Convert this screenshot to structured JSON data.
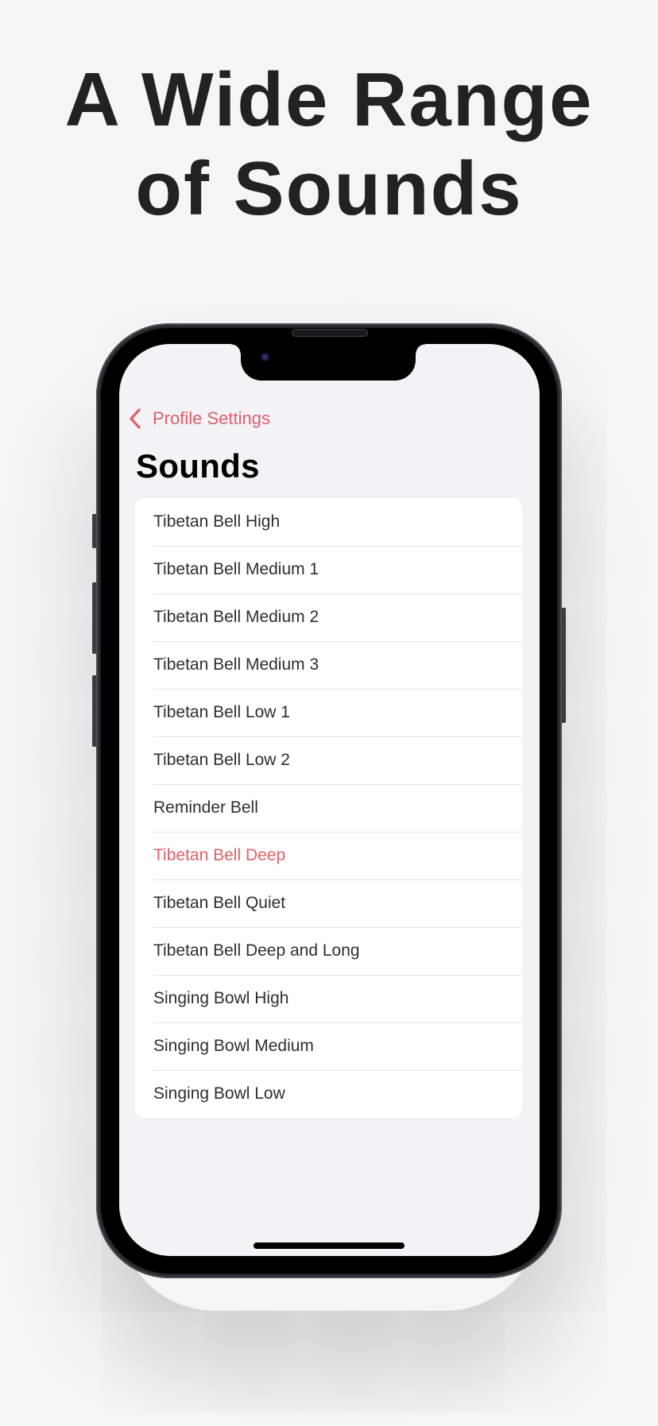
{
  "headline": {
    "line1": "A Wide Range",
    "line2": "of Sounds"
  },
  "nav": {
    "back_icon": "chevron-left-icon",
    "back_label": "Profile Settings"
  },
  "page": {
    "title": "Sounds"
  },
  "sounds": {
    "selected": "Tibetan Bell Deep",
    "items": [
      {
        "label": "Tibetan Bell High"
      },
      {
        "label": "Tibetan Bell Medium 1"
      },
      {
        "label": "Tibetan Bell Medium 2"
      },
      {
        "label": "Tibetan Bell Medium 3"
      },
      {
        "label": "Tibetan Bell Low 1"
      },
      {
        "label": "Tibetan Bell Low 2"
      },
      {
        "label": "Reminder Bell"
      },
      {
        "label": "Tibetan Bell Deep"
      },
      {
        "label": "Tibetan Bell Quiet"
      },
      {
        "label": "Tibetan Bell Deep and Long"
      },
      {
        "label": "Singing Bowl High"
      },
      {
        "label": "Singing Bowl Medium"
      },
      {
        "label": "Singing Bowl Low"
      }
    ]
  },
  "colors": {
    "accent": "#e0606a",
    "screen_background": "#f2f2f7",
    "page_background": "#f5f5f5",
    "headline_text": "#222222"
  }
}
